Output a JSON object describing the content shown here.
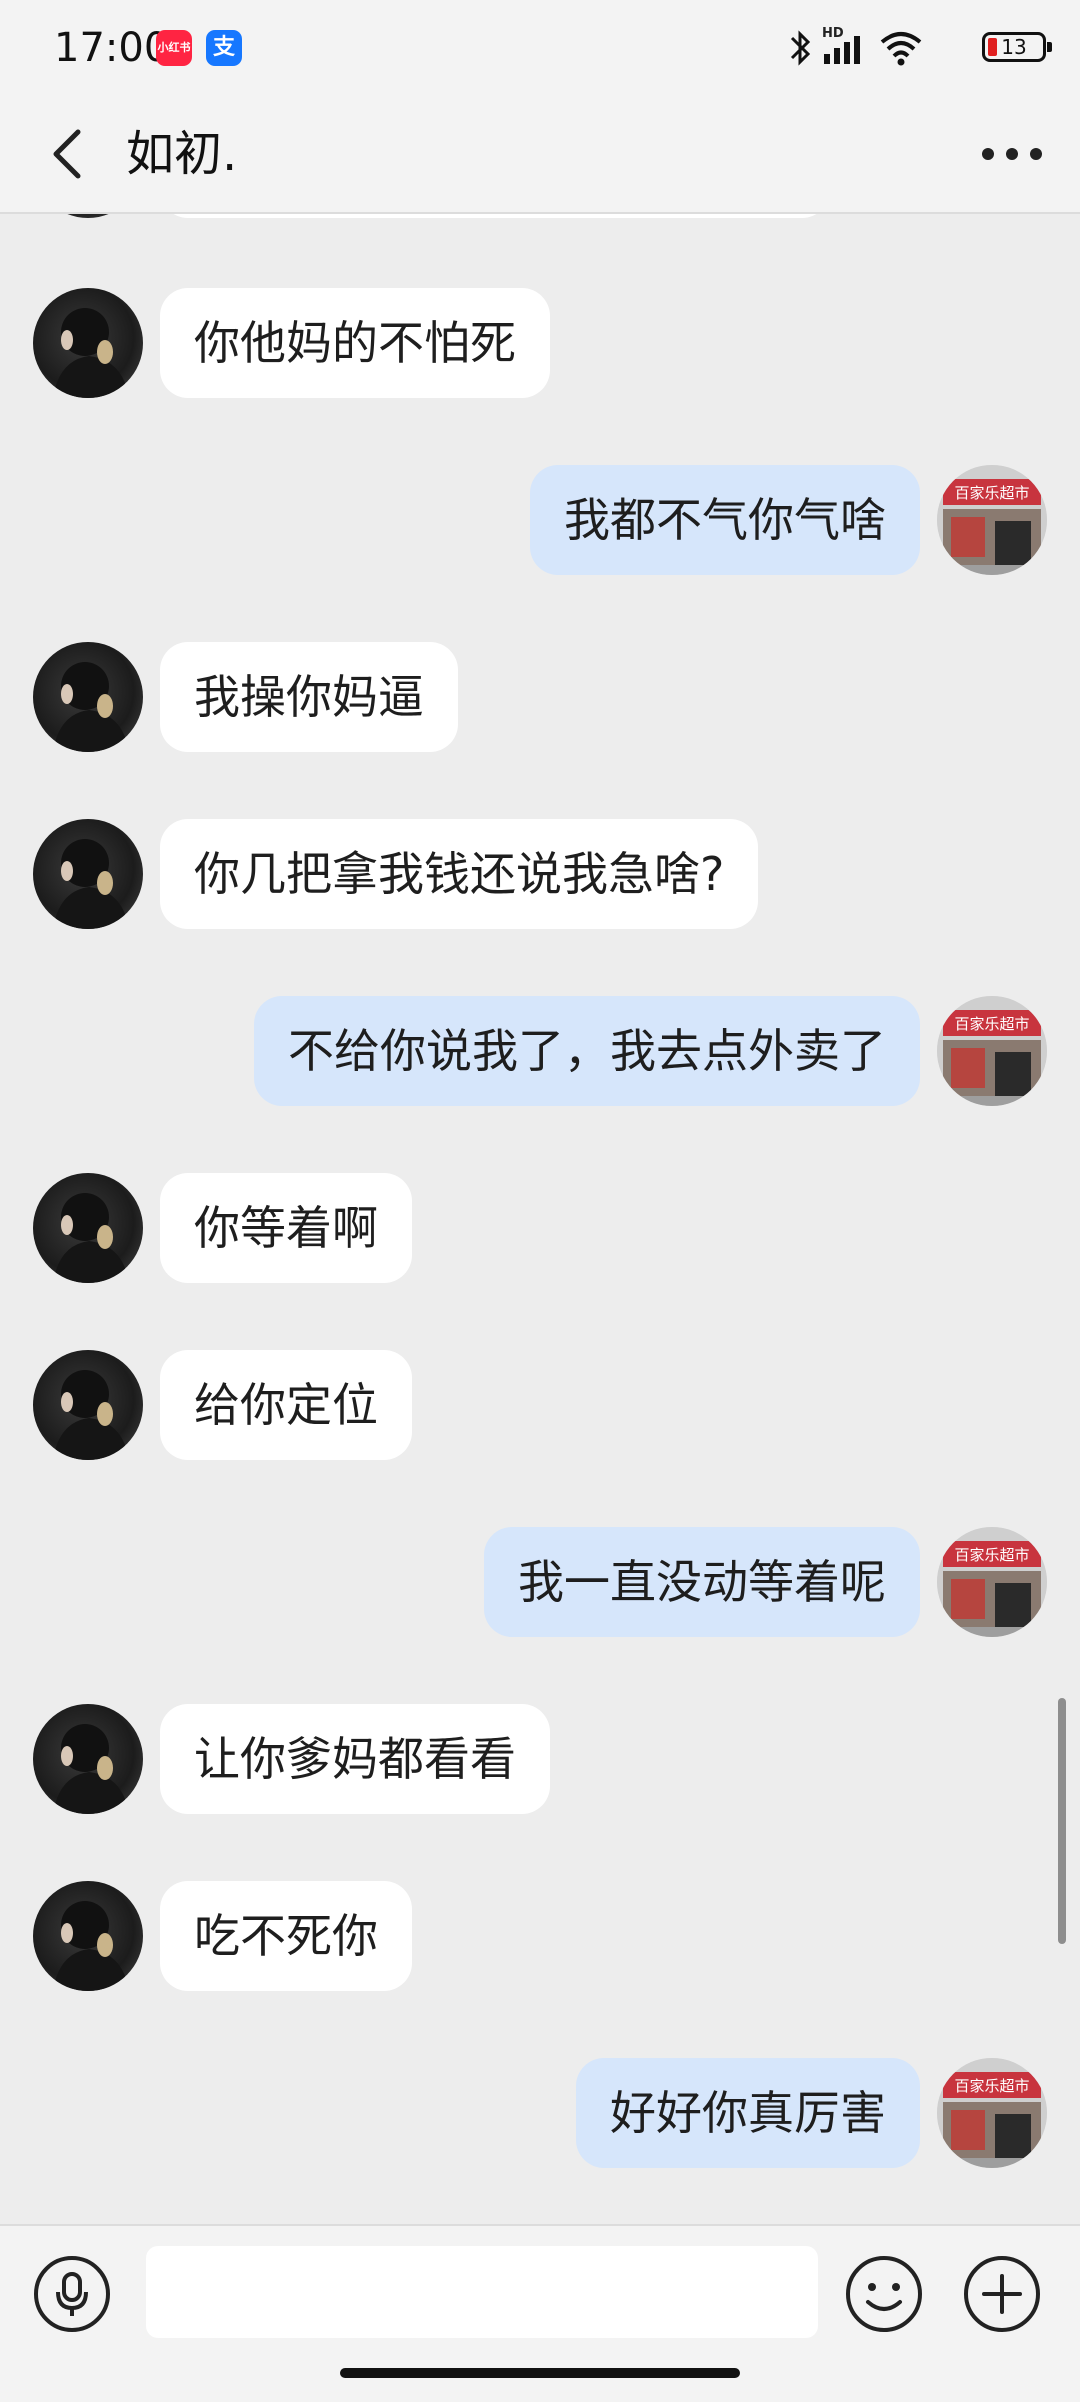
{
  "status_bar": {
    "time": "17:00",
    "app_badges": [
      "小红书",
      "支"
    ],
    "hd_label": "HD",
    "battery": "13"
  },
  "header": {
    "back_icon": "chevron-left-icon",
    "title": "如初.",
    "more_icon": "more-dots-icon"
  },
  "messages": [
    {
      "side": "left",
      "text": "你他妈的不怕死"
    },
    {
      "side": "right",
      "text": "我都不气你气啥"
    },
    {
      "side": "left",
      "text": "我操你妈逼"
    },
    {
      "side": "left",
      "text": "你几把拿我钱还说我急啥?"
    },
    {
      "side": "right",
      "text": "不给你说我了，我去点外卖了"
    },
    {
      "side": "left",
      "text": "你等着啊"
    },
    {
      "side": "left",
      "text": "给你定位"
    },
    {
      "side": "right",
      "text": "我一直没动等着呢"
    },
    {
      "side": "left",
      "text": "让你爹妈都看看"
    },
    {
      "side": "left",
      "text": "吃不死你"
    },
    {
      "side": "right",
      "text": "好好你真厉害"
    }
  ],
  "right_avatar_sign": "百家乐超市",
  "input_bar": {
    "placeholder": "",
    "mic_icon": "microphone-icon",
    "emoji_icon": "emoji-icon",
    "plus_icon": "plus-icon"
  },
  "colors": {
    "background": "#ededed",
    "incoming_bubble": "#ffffff",
    "outgoing_bubble": "#d6e6fb"
  }
}
